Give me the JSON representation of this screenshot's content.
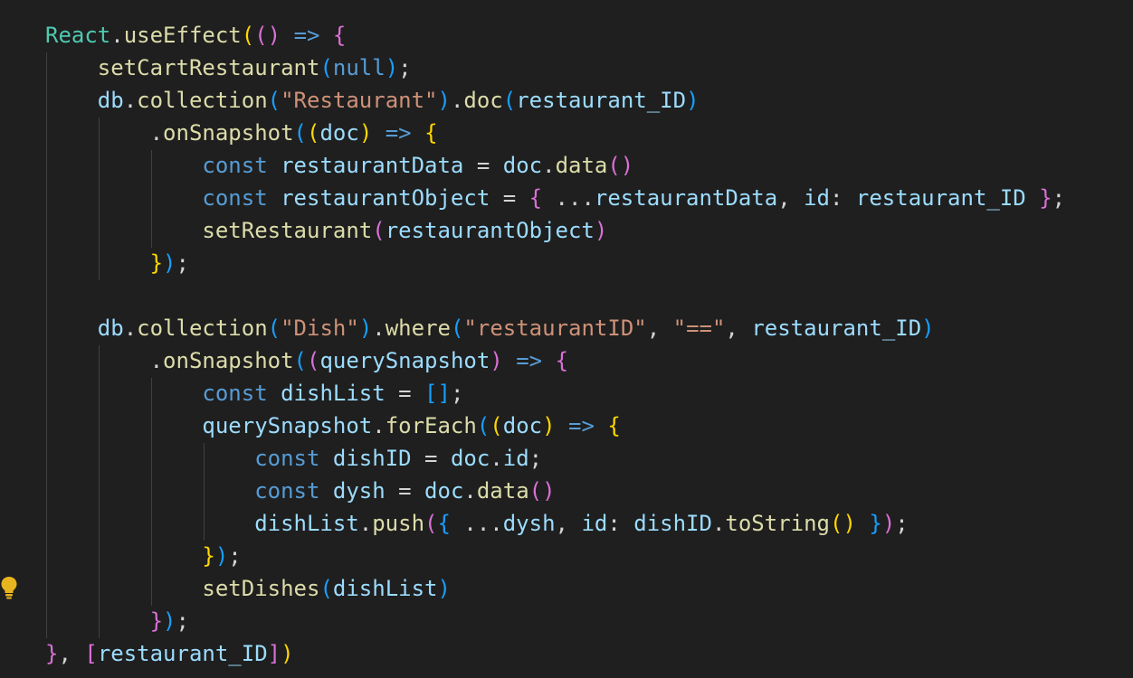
{
  "editor": {
    "theme": {
      "background": "#1f1f1f",
      "keyword": "#569cd6",
      "function": "#dcdcaa",
      "variable": "#9cdcfe",
      "string": "#ce9178",
      "text": "#d4d4d4",
      "bracket_gold": "#ffd700",
      "bracket_purple": "#da70d6",
      "bracket_blue": "#179fff"
    },
    "gutter_icon": "lightbulb-icon",
    "lines": [
      [
        {
          "t": "React",
          "c": "obj"
        },
        {
          "t": ".",
          "c": "plain"
        },
        {
          "t": "useEffect",
          "c": "fn"
        },
        {
          "t": "(",
          "c": "br1"
        },
        {
          "t": "()",
          "c": "br2"
        },
        {
          "t": " ",
          "c": "plain"
        },
        {
          "t": "=>",
          "c": "kw"
        },
        {
          "t": " ",
          "c": "plain"
        },
        {
          "t": "{",
          "c": "br2"
        }
      ],
      [
        {
          "t": "    ",
          "c": "plain"
        },
        {
          "t": "setCartRestaurant",
          "c": "fn"
        },
        {
          "t": "(",
          "c": "br3"
        },
        {
          "t": "null",
          "c": "kw"
        },
        {
          "t": ")",
          "c": "br3"
        },
        {
          "t": ";",
          "c": "plain"
        }
      ],
      [
        {
          "t": "    ",
          "c": "plain"
        },
        {
          "t": "db",
          "c": "var"
        },
        {
          "t": ".",
          "c": "plain"
        },
        {
          "t": "collection",
          "c": "fn"
        },
        {
          "t": "(",
          "c": "br3"
        },
        {
          "t": "\"Restaurant\"",
          "c": "str"
        },
        {
          "t": ")",
          "c": "br3"
        },
        {
          "t": ".",
          "c": "plain"
        },
        {
          "t": "doc",
          "c": "fn"
        },
        {
          "t": "(",
          "c": "br3"
        },
        {
          "t": "restaurant_ID",
          "c": "var"
        },
        {
          "t": ")",
          "c": "br3"
        }
      ],
      [
        {
          "t": "        ",
          "c": "plain"
        },
        {
          "t": ".",
          "c": "plain"
        },
        {
          "t": "onSnapshot",
          "c": "fn"
        },
        {
          "t": "(",
          "c": "br3"
        },
        {
          "t": "(",
          "c": "br1"
        },
        {
          "t": "doc",
          "c": "var"
        },
        {
          "t": ")",
          "c": "br1"
        },
        {
          "t": " ",
          "c": "plain"
        },
        {
          "t": "=>",
          "c": "kw"
        },
        {
          "t": " ",
          "c": "plain"
        },
        {
          "t": "{",
          "c": "br1"
        }
      ],
      [
        {
          "t": "            ",
          "c": "plain"
        },
        {
          "t": "const",
          "c": "kw"
        },
        {
          "t": " ",
          "c": "plain"
        },
        {
          "t": "restaurantData",
          "c": "var"
        },
        {
          "t": " = ",
          "c": "plain"
        },
        {
          "t": "doc",
          "c": "var"
        },
        {
          "t": ".",
          "c": "plain"
        },
        {
          "t": "data",
          "c": "fn"
        },
        {
          "t": "()",
          "c": "br2"
        }
      ],
      [
        {
          "t": "            ",
          "c": "plain"
        },
        {
          "t": "const",
          "c": "kw"
        },
        {
          "t": " ",
          "c": "plain"
        },
        {
          "t": "restaurantObject",
          "c": "var"
        },
        {
          "t": " = ",
          "c": "plain"
        },
        {
          "t": "{",
          "c": "br2"
        },
        {
          "t": " ...",
          "c": "plain"
        },
        {
          "t": "restaurantData",
          "c": "var"
        },
        {
          "t": ", ",
          "c": "plain"
        },
        {
          "t": "id",
          "c": "var"
        },
        {
          "t": ": ",
          "c": "plain"
        },
        {
          "t": "restaurant_ID",
          "c": "var"
        },
        {
          "t": " ",
          "c": "plain"
        },
        {
          "t": "}",
          "c": "br2"
        },
        {
          "t": ";",
          "c": "plain"
        }
      ],
      [
        {
          "t": "            ",
          "c": "plain"
        },
        {
          "t": "setRestaurant",
          "c": "fn"
        },
        {
          "t": "(",
          "c": "br2"
        },
        {
          "t": "restaurantObject",
          "c": "var"
        },
        {
          "t": ")",
          "c": "br2"
        }
      ],
      [
        {
          "t": "        ",
          "c": "plain"
        },
        {
          "t": "}",
          "c": "br1"
        },
        {
          "t": ")",
          "c": "br3"
        },
        {
          "t": ";",
          "c": "plain"
        }
      ],
      [
        {
          "t": "",
          "c": "plain"
        }
      ],
      [
        {
          "t": "    ",
          "c": "plain"
        },
        {
          "t": "db",
          "c": "var"
        },
        {
          "t": ".",
          "c": "plain"
        },
        {
          "t": "collection",
          "c": "fn"
        },
        {
          "t": "(",
          "c": "br3"
        },
        {
          "t": "\"Dish\"",
          "c": "str"
        },
        {
          "t": ")",
          "c": "br3"
        },
        {
          "t": ".",
          "c": "plain"
        },
        {
          "t": "where",
          "c": "fn"
        },
        {
          "t": "(",
          "c": "br3"
        },
        {
          "t": "\"restaurantID\"",
          "c": "str"
        },
        {
          "t": ", ",
          "c": "plain"
        },
        {
          "t": "\"==\"",
          "c": "str"
        },
        {
          "t": ", ",
          "c": "plain"
        },
        {
          "t": "restaurant_ID",
          "c": "var"
        },
        {
          "t": ")",
          "c": "br3"
        }
      ],
      [
        {
          "t": "        ",
          "c": "plain"
        },
        {
          "t": ".",
          "c": "plain"
        },
        {
          "t": "onSnapshot",
          "c": "fn"
        },
        {
          "t": "(",
          "c": "br3"
        },
        {
          "t": "(",
          "c": "br2"
        },
        {
          "t": "querySnapshot",
          "c": "var"
        },
        {
          "t": ")",
          "c": "br2"
        },
        {
          "t": " ",
          "c": "plain"
        },
        {
          "t": "=>",
          "c": "kw"
        },
        {
          "t": " ",
          "c": "plain"
        },
        {
          "t": "{",
          "c": "br2"
        }
      ],
      [
        {
          "t": "            ",
          "c": "plain"
        },
        {
          "t": "const",
          "c": "kw"
        },
        {
          "t": " ",
          "c": "plain"
        },
        {
          "t": "dishList",
          "c": "var"
        },
        {
          "t": " = ",
          "c": "plain"
        },
        {
          "t": "[]",
          "c": "br3"
        },
        {
          "t": ";",
          "c": "plain"
        }
      ],
      [
        {
          "t": "            ",
          "c": "plain"
        },
        {
          "t": "querySnapshot",
          "c": "var"
        },
        {
          "t": ".",
          "c": "plain"
        },
        {
          "t": "forEach",
          "c": "fn"
        },
        {
          "t": "(",
          "c": "br3"
        },
        {
          "t": "(",
          "c": "br1"
        },
        {
          "t": "doc",
          "c": "var"
        },
        {
          "t": ")",
          "c": "br1"
        },
        {
          "t": " ",
          "c": "plain"
        },
        {
          "t": "=>",
          "c": "kw"
        },
        {
          "t": " ",
          "c": "plain"
        },
        {
          "t": "{",
          "c": "br1"
        }
      ],
      [
        {
          "t": "                ",
          "c": "plain"
        },
        {
          "t": "const",
          "c": "kw"
        },
        {
          "t": " ",
          "c": "plain"
        },
        {
          "t": "dishID",
          "c": "var"
        },
        {
          "t": " = ",
          "c": "plain"
        },
        {
          "t": "doc",
          "c": "var"
        },
        {
          "t": ".",
          "c": "plain"
        },
        {
          "t": "id",
          "c": "var"
        },
        {
          "t": ";",
          "c": "plain"
        }
      ],
      [
        {
          "t": "                ",
          "c": "plain"
        },
        {
          "t": "const",
          "c": "kw"
        },
        {
          "t": " ",
          "c": "plain"
        },
        {
          "t": "dysh",
          "c": "var"
        },
        {
          "t": " = ",
          "c": "plain"
        },
        {
          "t": "doc",
          "c": "var"
        },
        {
          "t": ".",
          "c": "plain"
        },
        {
          "t": "data",
          "c": "fn"
        },
        {
          "t": "()",
          "c": "br2"
        }
      ],
      [
        {
          "t": "                ",
          "c": "plain"
        },
        {
          "t": "dishList",
          "c": "var"
        },
        {
          "t": ".",
          "c": "plain"
        },
        {
          "t": "push",
          "c": "fn"
        },
        {
          "t": "(",
          "c": "br2"
        },
        {
          "t": "{",
          "c": "br3"
        },
        {
          "t": " ...",
          "c": "plain"
        },
        {
          "t": "dysh",
          "c": "var"
        },
        {
          "t": ", ",
          "c": "plain"
        },
        {
          "t": "id",
          "c": "var"
        },
        {
          "t": ": ",
          "c": "plain"
        },
        {
          "t": "dishID",
          "c": "var"
        },
        {
          "t": ".",
          "c": "plain"
        },
        {
          "t": "toString",
          "c": "fn"
        },
        {
          "t": "()",
          "c": "br1"
        },
        {
          "t": " ",
          "c": "plain"
        },
        {
          "t": "}",
          "c": "br3"
        },
        {
          "t": ")",
          "c": "br2"
        },
        {
          "t": ";",
          "c": "plain"
        }
      ],
      [
        {
          "t": "            ",
          "c": "plain"
        },
        {
          "t": "}",
          "c": "br1"
        },
        {
          "t": ")",
          "c": "br3"
        },
        {
          "t": ";",
          "c": "plain"
        }
      ],
      [
        {
          "t": "            ",
          "c": "plain"
        },
        {
          "t": "setDishes",
          "c": "fn"
        },
        {
          "t": "(",
          "c": "br3"
        },
        {
          "t": "dishList",
          "c": "var"
        },
        {
          "t": ")",
          "c": "br3"
        }
      ],
      [
        {
          "t": "        ",
          "c": "plain"
        },
        {
          "t": "}",
          "c": "br2"
        },
        {
          "t": ")",
          "c": "br3"
        },
        {
          "t": ";",
          "c": "plain"
        }
      ],
      [
        {
          "t": "}",
          "c": "br2"
        },
        {
          "t": ", ",
          "c": "plain"
        },
        {
          "t": "[",
          "c": "br2"
        },
        {
          "t": "restaurant_ID",
          "c": "var"
        },
        {
          "t": "]",
          "c": "br2"
        },
        {
          "t": ")",
          "c": "br1"
        }
      ]
    ]
  }
}
